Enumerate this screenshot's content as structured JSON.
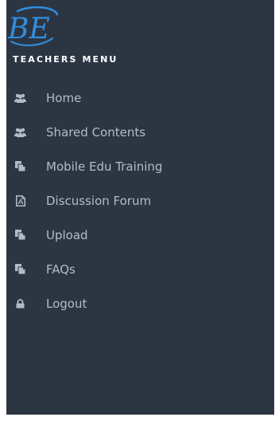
{
  "brand": {
    "logo_text": "BE",
    "logo_color": "#2f8fe0"
  },
  "sidebar": {
    "header": "TEACHERS MENU",
    "background": "#2c3643",
    "text_color": "#b3bcc6",
    "items": [
      {
        "label": "Home",
        "icon": "users-icon"
      },
      {
        "label": "Shared Contents",
        "icon": "users-icon"
      },
      {
        "label": "Mobile Edu Training",
        "icon": "copy-icon"
      },
      {
        "label": "Discussion Forum",
        "icon": "pdf-file-icon"
      },
      {
        "label": "Upload",
        "icon": "copy-icon"
      },
      {
        "label": "FAQs",
        "icon": "copy-icon"
      },
      {
        "label": "Logout",
        "icon": "lock-icon"
      }
    ]
  }
}
